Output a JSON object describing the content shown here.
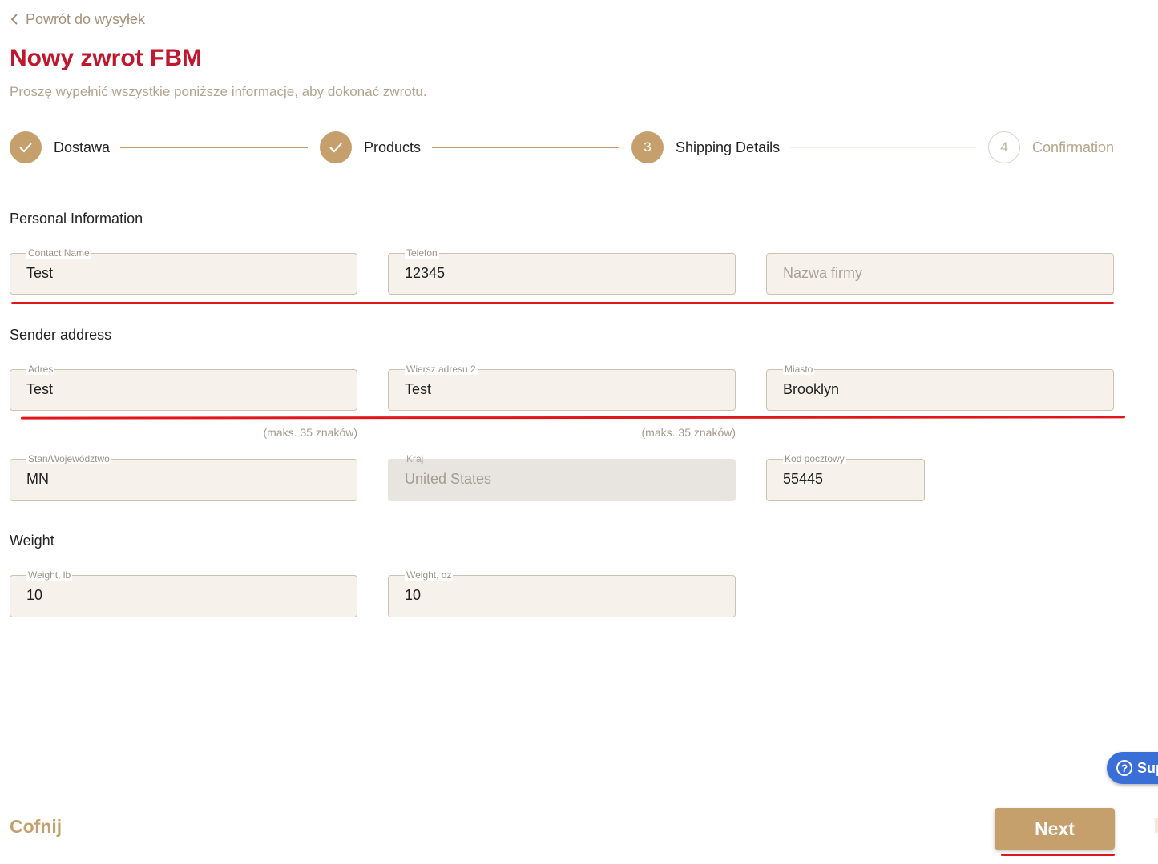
{
  "header": {
    "back_label": "Powrót do wysyłek",
    "title": "Nowy zwrot FBM",
    "subtitle": "Proszę wypełnić wszystkie poniższe informacje, aby dokonać zwrotu."
  },
  "stepper": {
    "steps": [
      {
        "label": "Dostawa",
        "state": "done",
        "number": ""
      },
      {
        "label": "Products",
        "state": "done",
        "number": ""
      },
      {
        "label": "Shipping Details",
        "state": "active",
        "number": "3"
      },
      {
        "label": "Confirmation",
        "state": "todo",
        "number": "4"
      }
    ]
  },
  "personal": {
    "title": "Personal Information",
    "contact_name": {
      "label": "Contact Name",
      "value": "Test"
    },
    "phone": {
      "label": "Telefon",
      "value": "12345"
    },
    "company": {
      "placeholder": "Nazwa firmy"
    }
  },
  "sender": {
    "title": "Sender address",
    "address": {
      "label": "Adres",
      "value": "Test",
      "hint": "(maks. 35 znaków)"
    },
    "address2": {
      "label": "Wiersz adresu 2",
      "value": "Test",
      "hint": "(maks. 35 znaków)"
    },
    "city": {
      "label": "Miasto",
      "value": "Brooklyn"
    },
    "state": {
      "label": "Stan/Województwo",
      "value": "MN"
    },
    "country": {
      "label": "Kraj",
      "value": "United States"
    },
    "zip": {
      "label": "Kod pocztowy",
      "value": "55445"
    }
  },
  "weight": {
    "title": "Weight",
    "lb": {
      "label": "Weight, lb",
      "value": "10"
    },
    "oz": {
      "label": "Weight, oz",
      "value": "10"
    }
  },
  "footer": {
    "back_label": "Cofnij",
    "next_label": "Next"
  },
  "support": {
    "label": "Sup"
  },
  "colors": {
    "brand_gold": "#c5a06c",
    "title_red": "#c0172e",
    "annotation_red": "#e0161b",
    "support_blue": "#3b6fd8"
  }
}
